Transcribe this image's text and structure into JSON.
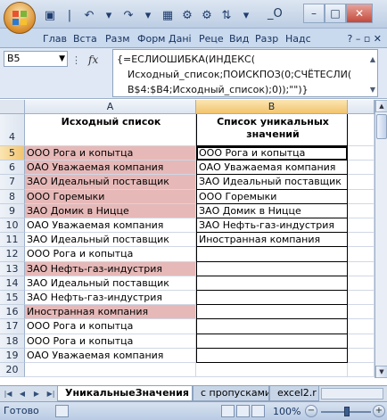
{
  "window": {
    "title": "_O"
  },
  "ribbon": {
    "tabs": [
      "Глав",
      "Вста",
      "Разм",
      "Форм",
      "Дані",
      "Реце",
      "Вид",
      "Разр",
      "Надс"
    ]
  },
  "formula_bar": {
    "cell_ref": "B5",
    "fx_label": "fx",
    "lines": [
      "{=ЕСЛИОШИБКА(ИНДЕКС(",
      "Исходный_список;ПОИСКПОЗ(0;СЧЁТЕСЛИ(",
      "B$4:$B4;Исходный_список);0));\"\")}"
    ]
  },
  "columns": [
    "A",
    "B"
  ],
  "header_row": {
    "row": "4",
    "a": "Исходный список",
    "b": "Список уникальных значений"
  },
  "rows": [
    {
      "n": "5",
      "a": "ООО Рога и копытца",
      "b": "ООО Рога и копытца",
      "hl": true
    },
    {
      "n": "6",
      "a": "ОАО Уважаемая компания",
      "b": "ОАО Уважаемая компания",
      "hl": true
    },
    {
      "n": "7",
      "a": "ЗАО Идеальный поставщик",
      "b": "ЗАО Идеальный поставщик",
      "hl": true
    },
    {
      "n": "8",
      "a": "ООО Горемыки",
      "b": "ООО Горемыки",
      "hl": true
    },
    {
      "n": "9",
      "a": "ЗАО Домик в Ницце",
      "b": "ЗАО Домик в Ницце",
      "hl": true
    },
    {
      "n": "10",
      "a": "ОАО Уважаемая компания",
      "b": "ЗАО Нефть-газ-индустрия",
      "hl": false
    },
    {
      "n": "11",
      "a": "ЗАО Идеальный поставщик",
      "b": "Иностранная компания",
      "hl": false
    },
    {
      "n": "12",
      "a": "ООО Рога и копытца",
      "b": "",
      "hl": false
    },
    {
      "n": "13",
      "a": "ЗАО Нефть-газ-индустрия",
      "b": "",
      "hl": true
    },
    {
      "n": "14",
      "a": "ЗАО Идеальный поставщик",
      "b": "",
      "hl": false
    },
    {
      "n": "15",
      "a": "ЗАО Нефть-газ-индустрия",
      "b": "",
      "hl": false
    },
    {
      "n": "16",
      "a": "Иностранная компания",
      "b": "",
      "hl": true
    },
    {
      "n": "17",
      "a": "ООО Рога и копытца",
      "b": "",
      "hl": false
    },
    {
      "n": "18",
      "a": "ООО Рога и копытца",
      "b": "",
      "hl": false
    },
    {
      "n": "19",
      "a": "ОАО Уважаемая компания",
      "b": "",
      "hl": false
    },
    {
      "n": "20",
      "a": "",
      "b": "",
      "hl": false
    }
  ],
  "sheet_tabs": [
    "УникальныеЗначения",
    "с пропусками",
    "excel2.r"
  ],
  "status": {
    "ready": "Готово",
    "zoom": "100%",
    "zoom_minus": "−",
    "zoom_plus": "+"
  },
  "colors": {
    "highlight": "#e6b9b8",
    "accent": "#1e395b"
  }
}
